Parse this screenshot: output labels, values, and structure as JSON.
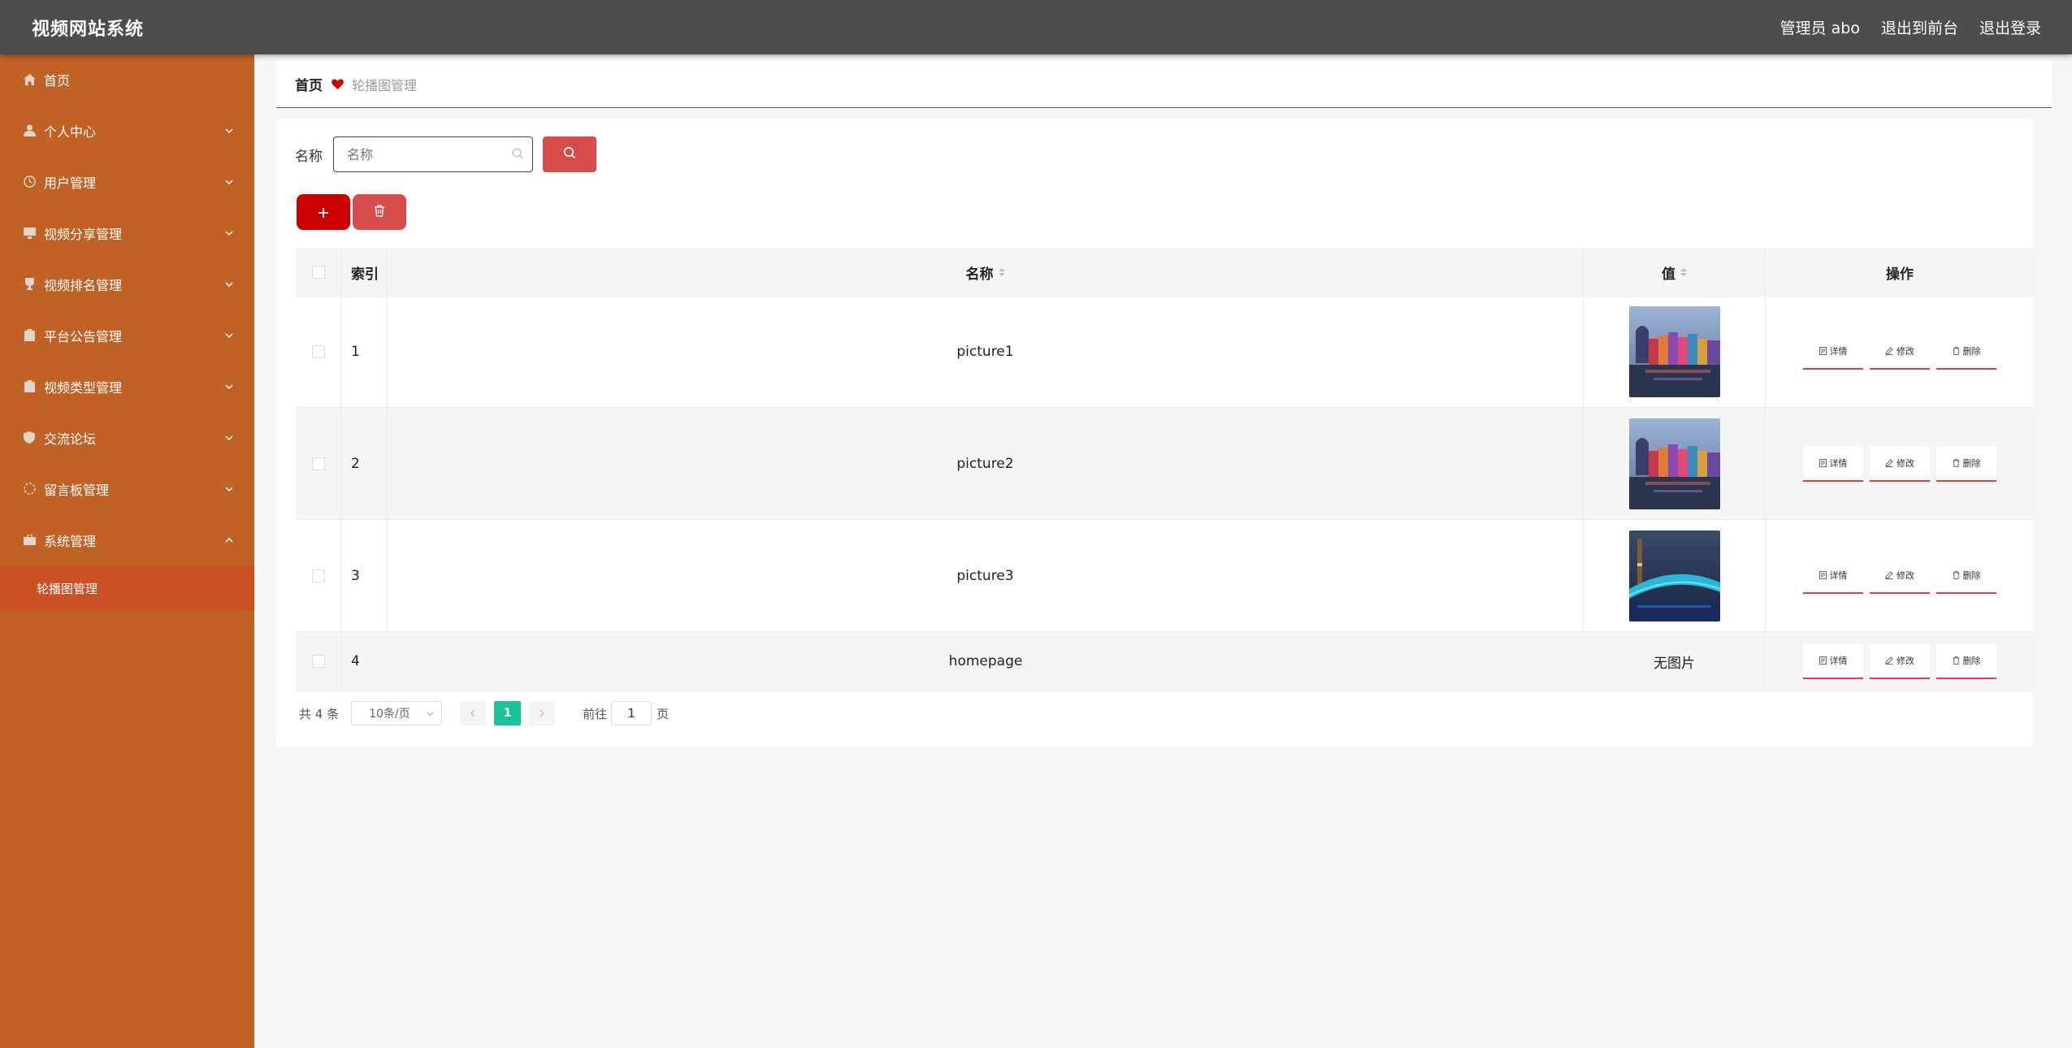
{
  "header": {
    "title": "视频网站系统",
    "user": "管理员 abo",
    "to_front": "退出到前台",
    "logout": "退出登录"
  },
  "sidebar": {
    "items": [
      {
        "label": "首页",
        "icon": "home-icon"
      },
      {
        "label": "个人中心",
        "icon": "user-icon"
      },
      {
        "label": "用户管理",
        "icon": "clock-icon"
      },
      {
        "label": "视频分享管理",
        "icon": "monitor-icon"
      },
      {
        "label": "视频排名管理",
        "icon": "trophy-icon"
      },
      {
        "label": "平台公告管理",
        "icon": "clipboard-icon"
      },
      {
        "label": "视频类型管理",
        "icon": "clipboard-icon"
      },
      {
        "label": "交流论坛",
        "icon": "shield-icon"
      },
      {
        "label": "留言板管理",
        "icon": "circle-icon"
      },
      {
        "label": "系统管理",
        "icon": "briefcase-icon"
      }
    ],
    "subitem": "轮播图管理"
  },
  "breadcrumb": {
    "home": "首页",
    "current": "轮播图管理"
  },
  "search": {
    "label": "名称",
    "placeholder": "名称"
  },
  "table": {
    "headers": {
      "index": "索引",
      "name": "名称",
      "value": "值",
      "ops": "操作"
    },
    "rows": [
      {
        "index": "1",
        "name": "picture1",
        "value": "image"
      },
      {
        "index": "2",
        "name": "picture2",
        "value": "image"
      },
      {
        "index": "3",
        "name": "picture3",
        "value": "image"
      },
      {
        "index": "4",
        "name": "homepage",
        "value": "无图片"
      }
    ],
    "ops": {
      "detail": "详情",
      "edit": "修改",
      "delete": "删除"
    }
  },
  "pagination": {
    "total": "共 4 条",
    "page_size": "10条/页",
    "current_page": "1",
    "goto_label": "前往",
    "goto_value": "1",
    "page_suffix": "页"
  },
  "colors": {
    "header_bg": "#4d4d4d",
    "sidebar_bg": "#c06125",
    "submenu_active_bg": "#c95124",
    "accent_red": "#cc0000",
    "pager_active": "#19c39b"
  }
}
